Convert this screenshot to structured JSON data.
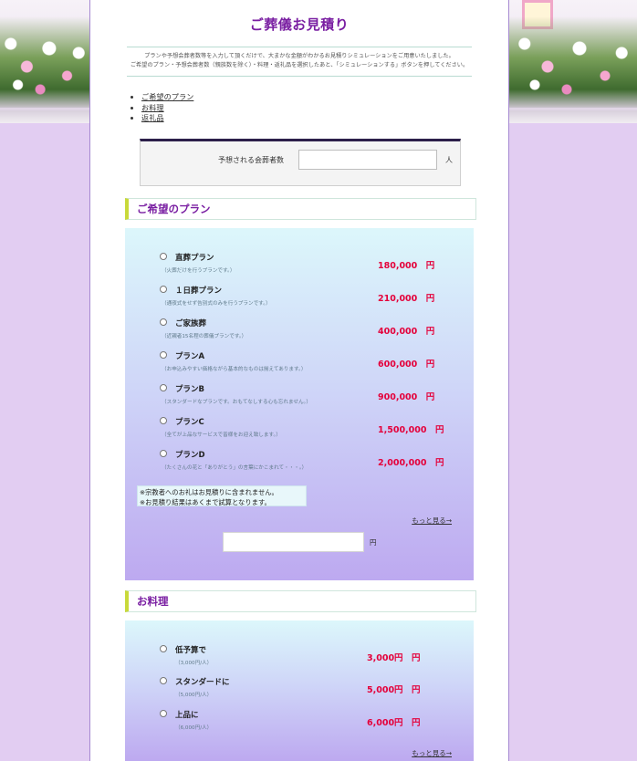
{
  "page": {
    "title": "ご葬儀お見積り",
    "intro_lines": [
      "プランや予想会葬者数等を入力して頂くだけで、大まかな金額がわかるお見積りシミュレーションをご用意いたしました。",
      "ご希望のプラン・予想会葬者数（親族数を除く）・料理・返礼品を選択したあと、「シミュレーションする」ボタンを押してください。"
    ]
  },
  "toc": [
    "ご希望のプラン",
    "お料理",
    "返礼品"
  ],
  "attendees": {
    "label": "予想される会葬者数",
    "unit": "人",
    "value": ""
  },
  "plan_section": {
    "heading": "ご希望のプラン",
    "plans": [
      {
        "name": "直葬プラン",
        "desc": "（火葬だけを行うプランです。）",
        "price": "180,000　円"
      },
      {
        "name": "１日葬プラン",
        "desc": "（通夜式をせず告別式のみを行うプランです。）",
        "price": "210,000　円"
      },
      {
        "name": "ご家族葬",
        "desc": "（近親者15名程の葬儀プランです。）",
        "price": "400,000　円"
      },
      {
        "name": "プランA",
        "desc": "（お申込みやすい価格ながら基本的なものは揃えてあります。）",
        "price": "600,000　円"
      },
      {
        "name": "プランB",
        "desc": "（スタンダードなプランです。おもてなしする心も忘れません。）",
        "price": "900,000　円"
      },
      {
        "name": "プランC",
        "desc": "（全てが上品なサービスで皆様をお迎え致します。）",
        "price": "1,500,000　円"
      },
      {
        "name": "プランD",
        "desc": "（たくさんの花と「ありがとう」の言葉にかこまれて・・・。）",
        "price": "2,000,000　円"
      }
    ],
    "notes": [
      "※宗教者へのお礼はお見積りに含まれません。",
      "※お見積り結果はあくまで試算となります。"
    ],
    "more_link": "もっと見る→",
    "total_unit": "円"
  },
  "food_section": {
    "heading": "お料理",
    "options": [
      {
        "name": "低予算で",
        "desc": "（3,000円/人）",
        "price": "3,000円　円"
      },
      {
        "name": "スタンダードに",
        "desc": "（5,000円/人）",
        "price": "5,000円　円"
      },
      {
        "name": "上品に",
        "desc": "（6,000円/人）",
        "price": "6,000円　円"
      }
    ],
    "more_link": "もっと見る→"
  }
}
